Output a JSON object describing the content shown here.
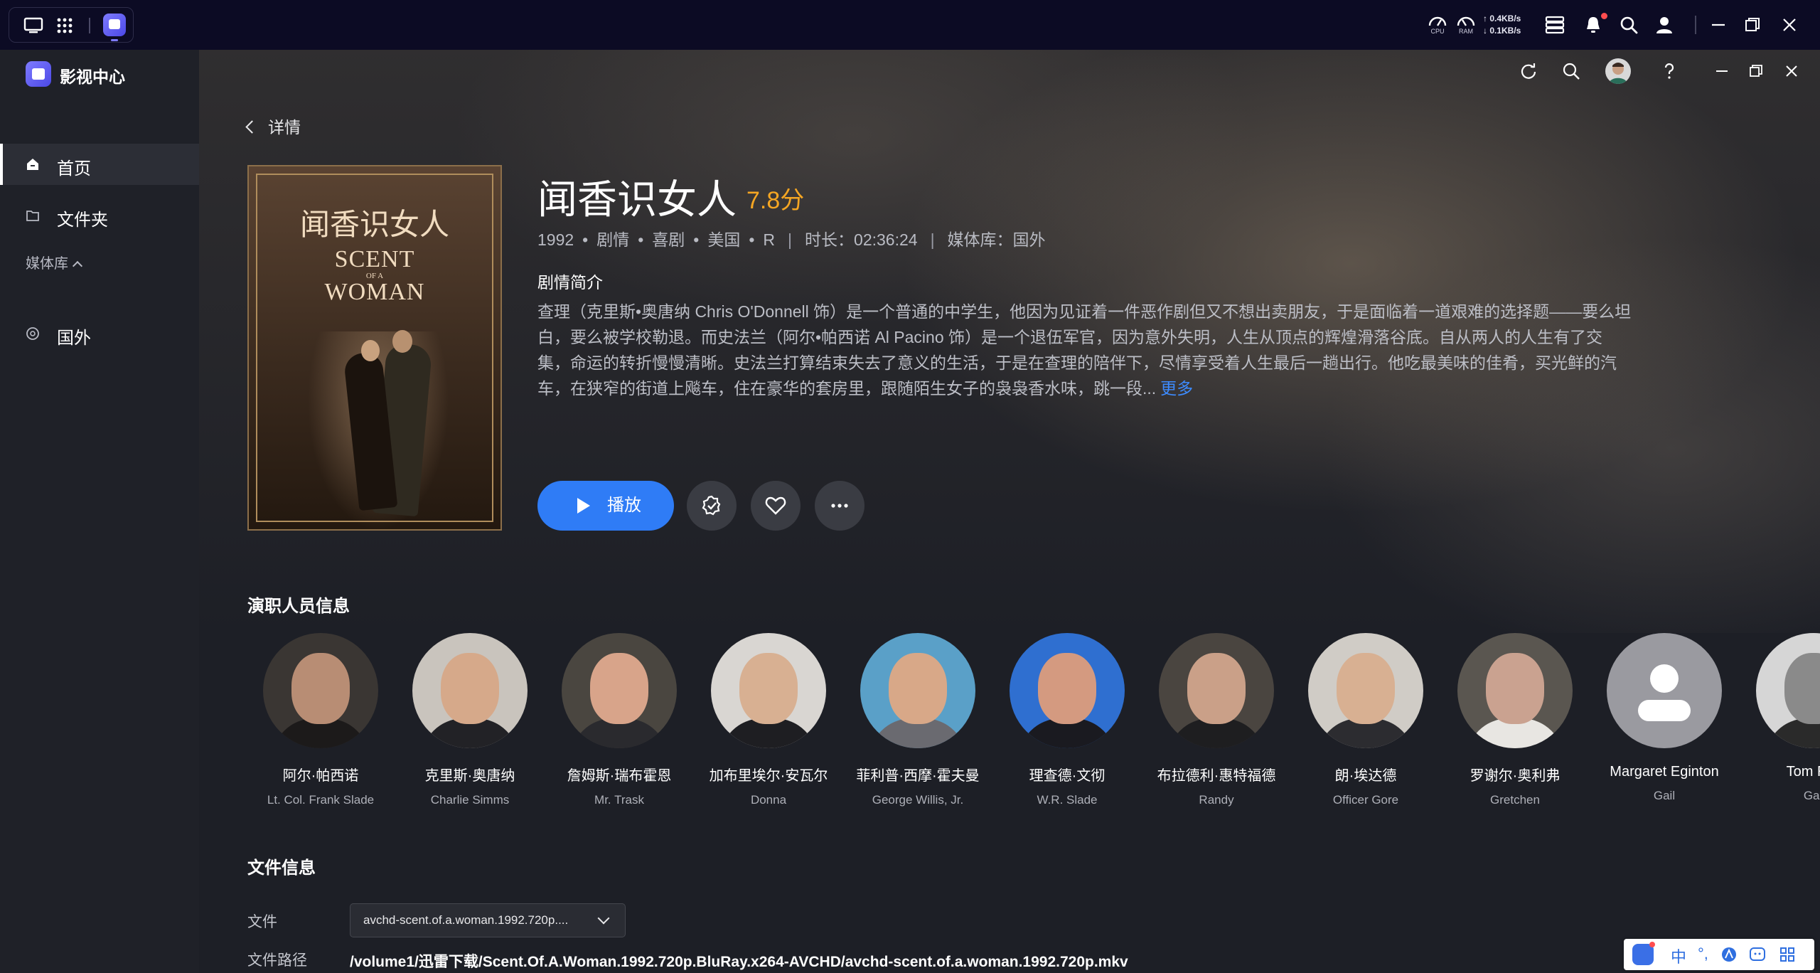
{
  "taskbar": {
    "cpu_label": "CPU",
    "ram_label": "RAM",
    "upload": "↑ 0.4KB/s",
    "download": "↓ 0.1KB/s"
  },
  "app": {
    "title": "影视中心"
  },
  "sidebar": {
    "items": [
      {
        "label": "首页",
        "icon": "home-icon",
        "active": true
      },
      {
        "label": "文件夹",
        "icon": "folder-icon",
        "active": false
      }
    ],
    "section_label": "媒体库",
    "library_items": [
      {
        "label": "国外",
        "icon": "globe-icon"
      }
    ]
  },
  "detail": {
    "back_label": "详情",
    "title": "闻香识女人",
    "rating": "7.8分",
    "year": "1992",
    "genres": [
      "剧情",
      "喜剧",
      "美国",
      "R"
    ],
    "duration_label": "时长：02:36:24",
    "library_label": "媒体库：国外",
    "synopsis_heading": "剧情简介",
    "synopsis": "查理（克里斯•奥唐纳 Chris O'Donnell 饰）是一个普通的中学生，他因为见证着一件恶作剧但又不想出卖朋友，于是面临着一道艰难的选择题——要么坦白，要么被学校勒退。而史法兰（阿尔•帕西诺 Al Pacino 饰）是一个退伍军官，因为意外失明，人生从顶点的辉煌滑落谷底。自从两人的人生有了交集，命运的转折慢慢清晰。史法兰打算结束失去了意义的生活，于是在查理的陪伴下，尽情享受着人生最后一趟出行。他吃最美味的佳肴，买光鲜的汽车，在狭窄的街道上飚车，住在豪华的套房里，跟随陌生女子的袅袅香水味，跳一段...",
    "more_label": "更多",
    "play_label": "播放",
    "poster": {
      "title_cn": "闻香识女人",
      "title_en_1": "SCENT",
      "title_en_of": "OF A",
      "title_en_2": "WOMAN"
    }
  },
  "cast_section": {
    "title": "演职人员信息",
    "members": [
      {
        "name": "阿尔·帕西诺",
        "role": "Lt. Col. Frank Slade",
        "bg": "#3a3633",
        "skin": "#b88d74",
        "suit": "#1c1a1a"
      },
      {
        "name": "克里斯·奥唐纳",
        "role": "Charlie Simms",
        "bg": "#c9c4bd",
        "skin": "#d6a98a",
        "suit": "#222226"
      },
      {
        "name": "詹姆斯·瑞布霍恩",
        "role": "Mr. Trask",
        "bg": "#4a4640",
        "skin": "#d8a48a",
        "suit": "#2a2a2e"
      },
      {
        "name": "加布里埃尔·安瓦尔",
        "role": "Donna",
        "bg": "#d9d6d2",
        "skin": "#d8b092",
        "suit": "#1e1e22"
      },
      {
        "name": "菲利普·西摩·霍夫曼",
        "role": "George Willis, Jr.",
        "bg": "#5aa0c8",
        "skin": "#d8a888",
        "suit": "#6a6a70"
      },
      {
        "name": "理查德·文彻",
        "role": "W.R. Slade",
        "bg": "#2f6fd0",
        "skin": "#d49a80",
        "suit": "#1a1a20"
      },
      {
        "name": "布拉德利·惠特福德",
        "role": "Randy",
        "bg": "#4a4540",
        "skin": "#caa088",
        "suit": "#1e1e20"
      },
      {
        "name": "朗·埃达德",
        "role": "Officer Gore",
        "bg": "#d0ccc6",
        "skin": "#d8b092",
        "suit": "#2c2c30"
      },
      {
        "name": "罗谢尔·奥利弗",
        "role": "Gretchen",
        "bg": "#5a5650",
        "skin": "#caa290",
        "suit": "#e8e6e2"
      },
      {
        "name": "Margaret Eginton",
        "role": "Gail",
        "placeholder": true
      },
      {
        "name": "Tom Riis",
        "role": "Gar",
        "bg": "#d6d6d6",
        "skin": "#8a8a8a",
        "suit": "#2a2a2a"
      }
    ]
  },
  "file_section": {
    "title": "文件信息",
    "file_label": "文件",
    "file_value": "avchd-scent.of.a.woman.1992.720p....",
    "path_label": "文件路径",
    "path_value": "/volume1/迅雷下载/Scent.Of.A.Woman.1992.720p.BluRay.x264-AVCHD/avchd-scent.of.a.woman.1992.720p.mkv"
  },
  "ime": {
    "mode": "中",
    "punct": "°,"
  },
  "colors": {
    "accent": "#2f7cf6",
    "rating": "#f5a623",
    "link": "#3d8bff"
  }
}
